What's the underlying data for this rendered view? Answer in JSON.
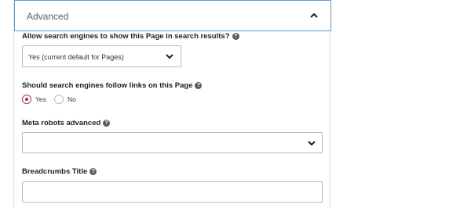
{
  "panel": {
    "title": "Advanced",
    "toggle_icon": "chevron-up-icon"
  },
  "search_visibility": {
    "label": "Allow search engines to show this Page in search results?",
    "help_icon": "?",
    "selected": "Yes (current default for Pages)"
  },
  "follow_links": {
    "label": "Should search engines follow links on this Page",
    "help_icon": "?",
    "options": [
      {
        "label": "Yes",
        "checked": true
      },
      {
        "label": "No",
        "checked": false
      }
    ]
  },
  "meta_robots": {
    "label": "Meta robots advanced",
    "help_icon": "?",
    "selected": ""
  },
  "breadcrumbs_title": {
    "label": "Breadcrumbs Title",
    "help_icon": "?",
    "value": ""
  },
  "colors": {
    "accent": "#a4286a",
    "focus_border": "#5b9dd9"
  }
}
